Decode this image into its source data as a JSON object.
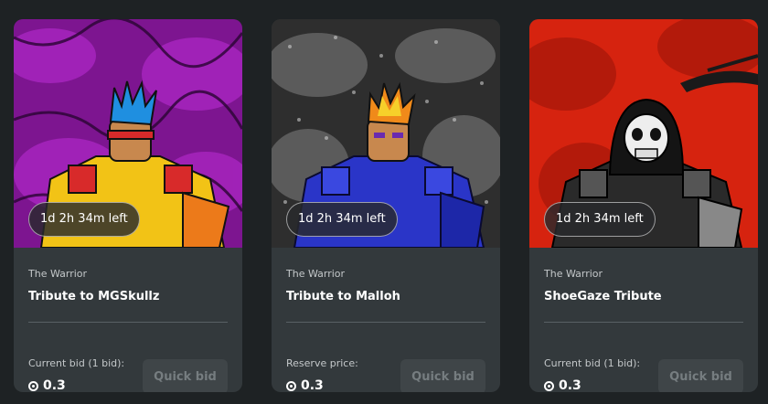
{
  "cards": [
    {
      "timer": "1d 2h 34m left",
      "collection": "The Warrior",
      "title": "Tribute to MGSkullz",
      "bid_label": "Current bid  (1 bid):",
      "bid_value": "0.3",
      "button": "Quick bid",
      "colors": {
        "background": "#8a1aa0",
        "armor": "#f2c316",
        "hair": "#1f8fe0"
      }
    },
    {
      "timer": "1d 2h 34m left",
      "collection": "The Warrior",
      "title": "Tribute to Malloh",
      "bid_label": "Reserve price:",
      "bid_value": "0.3",
      "button": "Quick bid",
      "colors": {
        "background": "#3a3a3a",
        "armor": "#2a35c8",
        "hair": "#f08a1a"
      }
    },
    {
      "timer": "1d 2h 34m left",
      "collection": "The Warrior",
      "title": "ShoeGaze Tribute",
      "bid_label": "Current bid  (1 bid):",
      "bid_value": "0.3",
      "button": "Quick bid",
      "colors": {
        "background": "#d6230f",
        "armor": "#2a2a2a",
        "hair": "#ffffff"
      }
    }
  ]
}
